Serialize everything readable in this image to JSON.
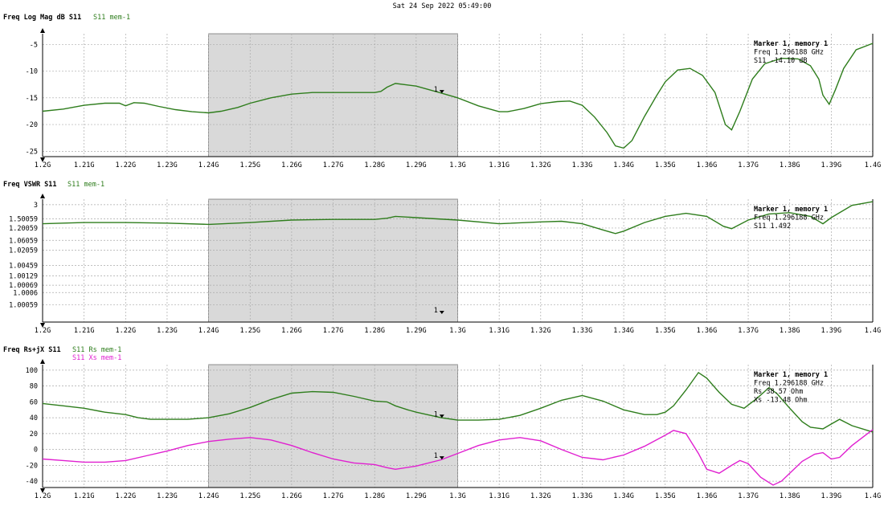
{
  "header": {
    "timestamp": "Sat 24 Sep 2022 05:49:00"
  },
  "chart_data": [
    {
      "type": "line",
      "title": "Freq Log Mag dB S11",
      "xticks": [
        "1.2G",
        "1.21G",
        "1.22G",
        "1.23G",
        "1.24G",
        "1.25G",
        "1.26G",
        "1.27G",
        "1.28G",
        "1.29G",
        "1.3G",
        "1.31G",
        "1.32G",
        "1.33G",
        "1.34G",
        "1.35G",
        "1.36G",
        "1.37G",
        "1.38G",
        "1.39G",
        "1.4G"
      ],
      "xlim": [
        1.2,
        1.4
      ],
      "ylim": [
        -26,
        -3
      ],
      "yticks": [
        {
          "v": -5,
          "label": "-5"
        },
        {
          "v": -10,
          "label": "-10"
        },
        {
          "v": -15,
          "label": "-15"
        },
        {
          "v": -20,
          "label": "-20"
        },
        {
          "v": -25,
          "label": "-25"
        }
      ],
      "highlight": [
        1.24,
        1.3
      ],
      "series": [
        {
          "name": "S11 mem-1",
          "color": "#2e7d1c",
          "x": [
            1.2,
            1.205,
            1.21,
            1.215,
            1.2185,
            1.22,
            1.222,
            1.2245,
            1.228,
            1.232,
            1.236,
            1.24,
            1.243,
            1.247,
            1.25,
            1.255,
            1.26,
            1.265,
            1.27,
            1.275,
            1.28,
            1.2815,
            1.283,
            1.285,
            1.29,
            1.296,
            1.3,
            1.305,
            1.31,
            1.312,
            1.316,
            1.32,
            1.324,
            1.327,
            1.33,
            1.333,
            1.336,
            1.338,
            1.34,
            1.342,
            1.345,
            1.348,
            1.35,
            1.353,
            1.356,
            1.359,
            1.362,
            1.3645,
            1.366,
            1.368,
            1.371,
            1.374,
            1.378,
            1.382,
            1.385,
            1.387,
            1.388,
            1.3895,
            1.391,
            1.393,
            1.396,
            1.4
          ],
          "y": [
            -17.5,
            -17.1,
            -16.4,
            -16.0,
            -16.0,
            -16.5,
            -15.9,
            -16.0,
            -16.6,
            -17.2,
            -17.6,
            -17.8,
            -17.5,
            -16.8,
            -16.0,
            -15.0,
            -14.3,
            -14.0,
            -14.0,
            -14.0,
            -14.0,
            -13.8,
            -13.0,
            -12.3,
            -12.8,
            -14.1,
            -15.0,
            -16.5,
            -17.6,
            -17.6,
            -17.0,
            -16.1,
            -15.7,
            -15.6,
            -16.4,
            -18.6,
            -21.5,
            -24.0,
            -24.4,
            -23.0,
            -18.5,
            -14.5,
            -12.0,
            -9.8,
            -9.5,
            -10.8,
            -14.0,
            -20.0,
            -21.0,
            -17.5,
            -11.5,
            -8.6,
            -7.6,
            -7.7,
            -9.0,
            -11.5,
            -14.5,
            -16.2,
            -13.5,
            -9.5,
            -6.0,
            -4.8
          ]
        }
      ],
      "marker": {
        "label": "1",
        "x": 1.296188,
        "info": [
          "Marker 1, memory 1",
          "Freq     1.296188 GHz",
          "S11      -14.10 dB"
        ]
      }
    },
    {
      "type": "line",
      "title": "Freq VSWR S11",
      "xticks": [
        "1.2G",
        "1.21G",
        "1.22G",
        "1.23G",
        "1.24G",
        "1.25G",
        "1.26G",
        "1.27G",
        "1.28G",
        "1.29G",
        "1.3G",
        "1.31G",
        "1.32G",
        "1.33G",
        "1.34G",
        "1.35G",
        "1.36G",
        "1.37G",
        "1.38G",
        "1.39G",
        "1.4G"
      ],
      "xlim": [
        1.2,
        1.4
      ],
      "ylim": [
        0,
        10
      ],
      "yticks": [
        {
          "v": 9.55,
          "label": "3"
        },
        {
          "v": 8.4,
          "label": "1.50059"
        },
        {
          "v": 7.65,
          "label": "1.20059"
        },
        {
          "v": 6.65,
          "label": "1.06059"
        },
        {
          "v": 5.85,
          "label": "1.02059"
        },
        {
          "v": 4.6,
          "label": "1.00459"
        },
        {
          "v": 3.75,
          "label": "1.00129"
        },
        {
          "v": 3.0,
          "label": "1.00069"
        },
        {
          "v": 2.4,
          "label": "1.0006"
        },
        {
          "v": 1.4,
          "label": "1.00059"
        }
      ],
      "highlight": [
        1.24,
        1.3
      ],
      "series": [
        {
          "name": "S11 mem-1",
          "color": "#2e7d1c",
          "x": [
            1.2,
            1.21,
            1.22,
            1.23,
            1.24,
            1.25,
            1.26,
            1.27,
            1.28,
            1.283,
            1.285,
            1.29,
            1.3,
            1.31,
            1.32,
            1.325,
            1.33,
            1.335,
            1.338,
            1.34,
            1.345,
            1.35,
            1.355,
            1.36,
            1.364,
            1.366,
            1.37,
            1.375,
            1.38,
            1.385,
            1.388,
            1.39,
            1.395,
            1.4
          ],
          "y": [
            8.0,
            8.1,
            8.1,
            8.05,
            7.95,
            8.1,
            8.3,
            8.35,
            8.35,
            8.45,
            8.6,
            8.5,
            8.3,
            8.0,
            8.15,
            8.2,
            8.0,
            7.5,
            7.2,
            7.4,
            8.1,
            8.6,
            8.85,
            8.6,
            7.8,
            7.6,
            8.3,
            8.8,
            8.9,
            8.6,
            8.0,
            8.5,
            9.5,
            9.8
          ]
        }
      ],
      "marker": {
        "label": "1",
        "x": 1.296188,
        "info": [
          "Marker 1, memory 1",
          "Freq     1.296188 GHz",
          "S11      1.492"
        ]
      }
    },
    {
      "type": "line",
      "title": "Freq Rs+jX S11",
      "xticks": [
        "1.2G",
        "1.21G",
        "1.22G",
        "1.23G",
        "1.24G",
        "1.25G",
        "1.26G",
        "1.27G",
        "1.28G",
        "1.29G",
        "1.3G",
        "1.31G",
        "1.32G",
        "1.33G",
        "1.34G",
        "1.35G",
        "1.36G",
        "1.37G",
        "1.38G",
        "1.39G",
        "1.4G"
      ],
      "xlim": [
        1.2,
        1.4
      ],
      "ylim": [
        -48,
        107
      ],
      "yticks": [
        {
          "v": 100,
          "label": "100"
        },
        {
          "v": 80,
          "label": "80"
        },
        {
          "v": 60,
          "label": "60"
        },
        {
          "v": 40,
          "label": "40"
        },
        {
          "v": 20,
          "label": "20"
        },
        {
          "v": 0,
          "label": "0"
        },
        {
          "v": -20,
          "label": "-20"
        },
        {
          "v": -40,
          "label": "-40"
        }
      ],
      "highlight": [
        1.24,
        1.3
      ],
      "series": [
        {
          "name": "S11 Rs mem-1",
          "color": "#2e7d1c",
          "x": [
            1.2,
            1.205,
            1.21,
            1.215,
            1.22,
            1.223,
            1.226,
            1.23,
            1.235,
            1.24,
            1.245,
            1.25,
            1.255,
            1.26,
            1.265,
            1.27,
            1.275,
            1.28,
            1.283,
            1.285,
            1.288,
            1.29,
            1.296,
            1.3,
            1.305,
            1.31,
            1.315,
            1.32,
            1.325,
            1.33,
            1.335,
            1.34,
            1.345,
            1.348,
            1.35,
            1.352,
            1.355,
            1.358,
            1.36,
            1.363,
            1.366,
            1.369,
            1.372,
            1.375,
            1.377,
            1.38,
            1.383,
            1.385,
            1.388,
            1.39,
            1.392,
            1.395,
            1.4
          ],
          "y": [
            58,
            55,
            52,
            47,
            44,
            40,
            38,
            38,
            38,
            40,
            45,
            53,
            63,
            71,
            73,
            72,
            67,
            61,
            60,
            55,
            50,
            47,
            40,
            37,
            37,
            38,
            43,
            52,
            62,
            68,
            61,
            50,
            44,
            44,
            47,
            55,
            75,
            97,
            90,
            72,
            57,
            52,
            64,
            78,
            70,
            52,
            35,
            28,
            26,
            32,
            38,
            30,
            22
          ]
        },
        {
          "name": "S11 Xs mem-1",
          "color": "#e020d0",
          "x": [
            1.2,
            1.205,
            1.21,
            1.215,
            1.22,
            1.225,
            1.23,
            1.235,
            1.24,
            1.245,
            1.25,
            1.255,
            1.26,
            1.265,
            1.27,
            1.275,
            1.28,
            1.283,
            1.285,
            1.29,
            1.296,
            1.3,
            1.305,
            1.31,
            1.315,
            1.32,
            1.325,
            1.33,
            1.335,
            1.34,
            1.345,
            1.35,
            1.352,
            1.355,
            1.358,
            1.36,
            1.363,
            1.366,
            1.368,
            1.37,
            1.373,
            1.376,
            1.378,
            1.38,
            1.383,
            1.386,
            1.388,
            1.39,
            1.392,
            1.395,
            1.4
          ],
          "y": [
            -12,
            -14,
            -16,
            -16,
            -14,
            -8,
            -2,
            5,
            10,
            13,
            15,
            12,
            5,
            -4,
            -12,
            -17,
            -19,
            -23,
            -25,
            -21,
            -13,
            -5,
            5,
            12,
            15,
            11,
            0,
            -10,
            -13,
            -7,
            4,
            18,
            24,
            20,
            -5,
            -25,
            -30,
            -20,
            -14,
            -18,
            -35,
            -45,
            -40,
            -30,
            -15,
            -6,
            -4,
            -12,
            -10,
            5,
            25
          ]
        }
      ],
      "marker": {
        "label": "1",
        "x": 1.296188,
        "info": [
          "Marker 1, memory 1",
          "Freq     1.296188 GHz",
          "Rs       38.57 Ohm",
          "Xs       -13.48 Ohm"
        ]
      }
    }
  ]
}
